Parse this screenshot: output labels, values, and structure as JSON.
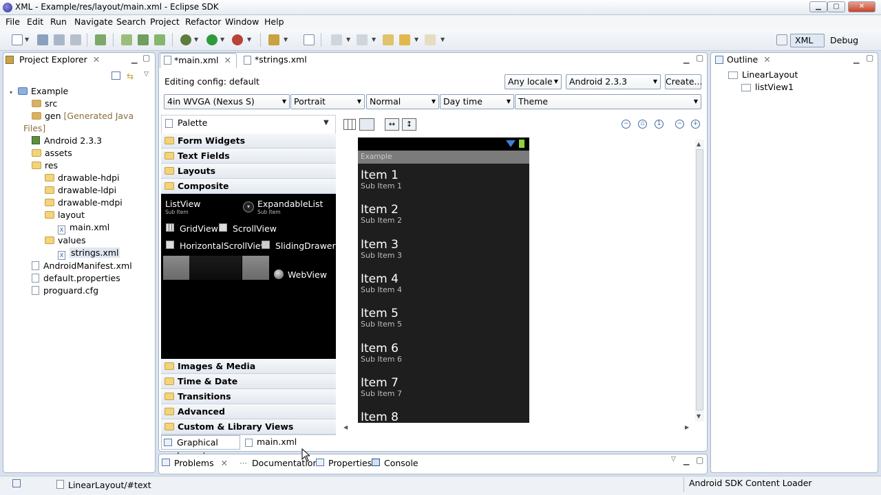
{
  "window": {
    "title": "XML - Example/res/layout/main.xml - Eclipse SDK"
  },
  "menu": [
    "File",
    "Edit",
    "Run",
    "Navigate",
    "Search",
    "Project",
    "Refactor",
    "Window",
    "Help"
  ],
  "perspective": {
    "active": "XML",
    "other": "Debug"
  },
  "explorer": {
    "title": "Project Explorer",
    "items": [
      {
        "label": "Example"
      },
      {
        "label": "src"
      },
      {
        "label": "gen",
        "note": "[Generated Java Files]"
      },
      {
        "label": "Android 2.3.3"
      },
      {
        "label": "assets"
      },
      {
        "label": "res"
      },
      {
        "label": "drawable-hdpi"
      },
      {
        "label": "drawable-ldpi"
      },
      {
        "label": "drawable-mdpi"
      },
      {
        "label": "layout"
      },
      {
        "label": "main.xml"
      },
      {
        "label": "values"
      },
      {
        "label": "strings.xml"
      },
      {
        "label": "AndroidManifest.xml"
      },
      {
        "label": "default.properties"
      },
      {
        "label": "proguard.cfg"
      }
    ]
  },
  "editor": {
    "tabs": [
      "*main.xml",
      "*strings.xml"
    ],
    "config_label": "Editing config:  default",
    "locale": "Any locale",
    "target": "Android 2.3.3",
    "create": "Create...",
    "device": "4in WVGA (Nexus S)",
    "orientation": "Portrait",
    "mode": "Normal",
    "time": "Day time",
    "theme": "Theme",
    "bottom_tabs": [
      "Graphical Layout",
      "main.xml"
    ]
  },
  "palette": {
    "title": "Palette",
    "top_groups": [
      "Form Widgets",
      "Text Fields",
      "Layouts",
      "Composite"
    ],
    "widgets": {
      "listview": "ListView",
      "expandable": "ExpandableList",
      "sub": "Sub Item",
      "gridview": "GridView",
      "scrollview": "ScrollView",
      "hscroll": "HorizontalScrollView",
      "sliding": "SlidingDrawer",
      "webview": "WebView"
    },
    "bottom_groups": [
      "Images & Media",
      "Time & Date",
      "Transitions",
      "Advanced",
      "Custom & Library Views"
    ]
  },
  "preview": {
    "app_title": "Example",
    "items": [
      {
        "title": "Item 1",
        "sub": "Sub Item 1"
      },
      {
        "title": "Item 2",
        "sub": "Sub Item 2"
      },
      {
        "title": "Item 3",
        "sub": "Sub Item 3"
      },
      {
        "title": "Item 4",
        "sub": "Sub Item 4"
      },
      {
        "title": "Item 5",
        "sub": "Sub Item 5"
      },
      {
        "title": "Item 6",
        "sub": "Sub Item 6"
      },
      {
        "title": "Item 7",
        "sub": "Sub Item 7"
      },
      {
        "title": "Item 8",
        "sub": ""
      }
    ]
  },
  "outline": {
    "title": "Outline",
    "root": "LinearLayout",
    "child": "listView1"
  },
  "bottom_panel": {
    "tabs": [
      "Problems",
      "Documentation",
      "Properties",
      "Console"
    ]
  },
  "status": {
    "path": "LinearLayout/#text",
    "loader": "Android SDK Content Loader"
  }
}
